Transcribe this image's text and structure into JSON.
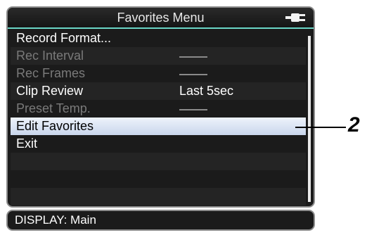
{
  "window": {
    "title": "Favorites Menu",
    "battery_icon": "power-plug-icon"
  },
  "menu": {
    "items": [
      {
        "label": "Record Format...",
        "value": "",
        "state": "enabled"
      },
      {
        "label": "Rec Interval",
        "value": "",
        "state": "disabled",
        "value_dash": true
      },
      {
        "label": "Rec Frames",
        "value": "",
        "state": "disabled",
        "value_dash": true
      },
      {
        "label": "Clip Review",
        "value": "Last 5sec",
        "state": "enabled"
      },
      {
        "label": "Preset Temp.",
        "value": "",
        "state": "disabled",
        "value_dash": true
      },
      {
        "label": "Edit Favorites",
        "value": "",
        "state": "selected"
      },
      {
        "label": "Exit",
        "value": "",
        "state": "enabled"
      }
    ]
  },
  "status": {
    "text": "DISPLAY: Main"
  },
  "callout": {
    "number": "2"
  },
  "colors": {
    "accent": "#6ad6c6",
    "selection": "#c9d6ec",
    "background": "#1b1b1b"
  }
}
